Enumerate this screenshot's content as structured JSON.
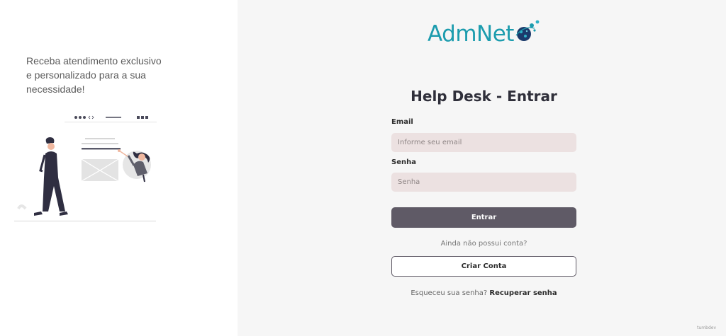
{
  "sidebar": {
    "tagline": "Receba atendimento exclusivo e personalizado para a sua necessidade!"
  },
  "brand": {
    "logo_text": "AdmNet",
    "logo_color": "#1c9cae",
    "accent_dark": "#1b3a6b"
  },
  "login": {
    "title": "Help Desk - Entrar",
    "email_label": "Email",
    "email_placeholder": "Informe seu email",
    "password_label": "Senha",
    "password_placeholder": "Senha",
    "submit_label": "Entrar",
    "no_account_text": "Ainda não possui conta?",
    "create_account_label": "Criar Conta",
    "forgot_text": "Esqueceu sua senha?",
    "recover_link": "Recuperar senha"
  },
  "footer": {
    "mark": "tumbdev"
  },
  "colors": {
    "input_bg": "#ece1e1",
    "primary_button": "#5f5a66",
    "page_bg": "#f6f6f6"
  }
}
